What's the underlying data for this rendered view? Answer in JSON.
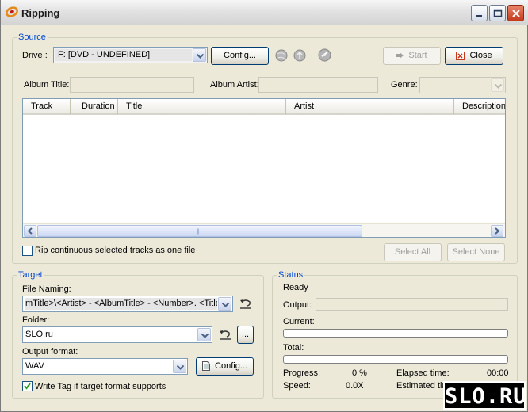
{
  "window": {
    "title": "Ripping"
  },
  "source": {
    "legend": "Source",
    "drive_label": "Drive :",
    "drive_value": "F:  [DVD - UNDEFINED]",
    "config_label": "Config...",
    "start_label": "Start",
    "close_label": "Close",
    "album_title_label": "Album Title:",
    "album_title_value": "",
    "album_artist_label": "Album Artist:",
    "album_artist_value": "",
    "genre_label": "Genre:",
    "genre_value": "",
    "columns": [
      "Track",
      "Duration",
      "Title",
      "Artist",
      "Description"
    ],
    "rip_continuous_label": "Rip continuous selected tracks as one file",
    "rip_continuous_checked": false,
    "select_all_label": "Select All",
    "select_none_label": "Select None"
  },
  "target": {
    "legend": "Target",
    "file_naming_label": "File Naming:",
    "file_naming_value": "mTitle>\\<Artist> - <AlbumTitle> - <Number>. <Title>",
    "folder_label": "Folder:",
    "folder_value": "SLO.ru",
    "browse_label": "...",
    "output_format_label": "Output format:",
    "output_format_value": "WAV",
    "config_label": "Config...",
    "write_tag_label": "Write Tag if target format supports",
    "write_tag_checked": true
  },
  "status": {
    "legend": "Status",
    "state": "Ready",
    "output_label": "Output:",
    "output_value": "",
    "current_label": "Current:",
    "current_progress": 0,
    "total_label": "Total:",
    "total_progress": 0,
    "progress_label": "Progress:",
    "progress_value": "0 %",
    "speed_label": "Speed:",
    "speed_value": "0.0X",
    "elapsed_label": "Elapsed time:",
    "elapsed_value": "00:00",
    "estimated_label": "Estimated tim"
  },
  "watermark": {
    "text": "SLO.RU"
  },
  "colors": {
    "legend": "#0046D5",
    "accent_close": "#C5391C"
  }
}
